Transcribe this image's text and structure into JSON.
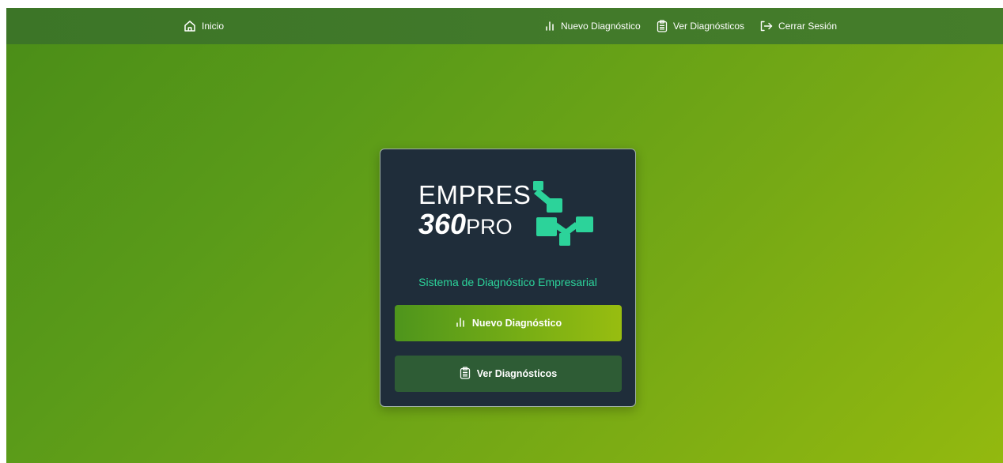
{
  "navbar": {
    "home": {
      "label": "Inicio",
      "icon": "home-icon"
    },
    "new_diagnostic": {
      "label": "Nuevo Diagnóstico",
      "icon": "bar-chart-icon"
    },
    "view_diagnostics": {
      "label": "Ver Diagnósticos",
      "icon": "clipboard-icon"
    },
    "logout": {
      "label": "Cerrar Sesión",
      "icon": "logout-icon"
    }
  },
  "card": {
    "logo": {
      "line1": "EMPRES",
      "number": "360",
      "suffix": "PRO"
    },
    "subtitle": "Sistema de Diagnóstico Empresarial",
    "primary_button": {
      "label": "Nuevo Diagnóstico",
      "icon": "bar-chart-icon"
    },
    "secondary_button": {
      "label": "Ver Diagnósticos",
      "icon": "clipboard-icon"
    }
  },
  "colors": {
    "navbar": "#41792a",
    "background_start": "#4a8d18",
    "background_end": "#93b90f",
    "card": "#1f2d3a",
    "accent_teal": "#2cd39a",
    "secondary_button": "#2e5c35"
  }
}
